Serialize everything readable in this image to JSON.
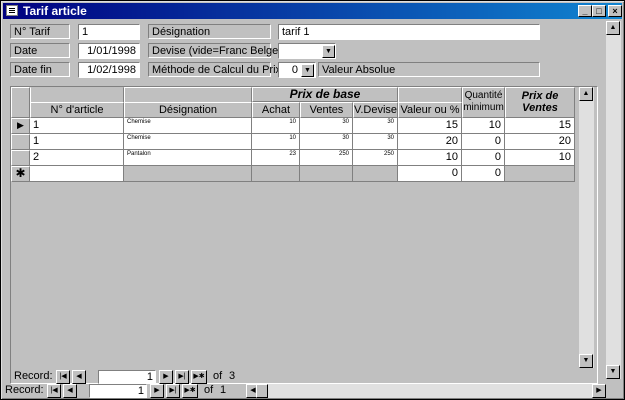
{
  "window": {
    "title": "Tarif  article"
  },
  "form": {
    "num_tarif_label": "N° Tarif",
    "num_tarif_value": "1",
    "designation_label": "Désignation",
    "designation_value": "tarif 1",
    "date_label": "Date",
    "date_value": "1/01/1998",
    "devise_label": "Devise (vide=Franc Belge)",
    "devise_value": "",
    "date_fin_label": "Date fin",
    "date_fin_value": "1/02/1998",
    "methode_label": "Méthode de Calcul du Prix",
    "methode_value": "0",
    "methode_text": "Valeur Absolue"
  },
  "grid": {
    "group_header": "Prix de base",
    "headers": {
      "article": "N° d'article",
      "designation": "Désignation",
      "achat": "Achat",
      "ventes": "Ventes",
      "vdevise": "V.Devise",
      "valeur": "Valeur ou %",
      "quantite": "Quantité minimum",
      "prix": "Prix de Ventes"
    },
    "rows": [
      {
        "article": "1",
        "designation": "Chemise",
        "achat": "10",
        "ventes": "30",
        "vdevise": "30",
        "valeur": "15",
        "quantite": "10",
        "prix": "15"
      },
      {
        "article": "1",
        "designation": "Chemise",
        "achat": "10",
        "ventes": "30",
        "vdevise": "30",
        "valeur": "20",
        "quantite": "0",
        "prix": "20"
      },
      {
        "article": "2",
        "designation": "Pantalon",
        "achat": "23",
        "ventes": "250",
        "vdevise": "250",
        "valeur": "10",
        "quantite": "0",
        "prix": "10"
      }
    ],
    "new_row": {
      "valeur": "0",
      "quantite": "0"
    }
  },
  "sub_nav": {
    "label": "Record:",
    "current": "1",
    "of_label": "of",
    "total": "3"
  },
  "main_nav": {
    "label": "Record:",
    "current": "1",
    "of_label": "of",
    "total": "1"
  }
}
